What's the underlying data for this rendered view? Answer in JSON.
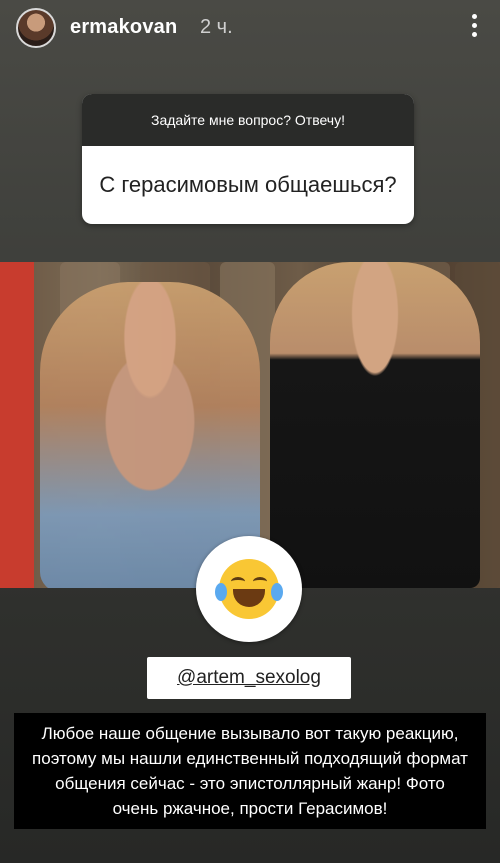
{
  "header": {
    "username": "ermakovan",
    "time": "2 ч."
  },
  "question": {
    "prompt": "Задайте мне вопрос? Отвечу!",
    "text": "С герасимовым общаешься?"
  },
  "sticker": {
    "emoji_name": "face-with-tears-of-joy"
  },
  "mention": {
    "text": "@artem_sexolog"
  },
  "caption": {
    "line1": "Любое наше общение вызывало вот такую реакцию,",
    "line2": "поэтому мы нашли единственный подходящий формат",
    "line3": "общения сейчас - это эпистоллярный жанр! Фото",
    "line4": "очень ржачное, прости Герасимов!"
  },
  "colors": {
    "accent_red": "#c83c2e",
    "question_header": "#2a2b29",
    "emoji_yellow": "#f9c734"
  }
}
